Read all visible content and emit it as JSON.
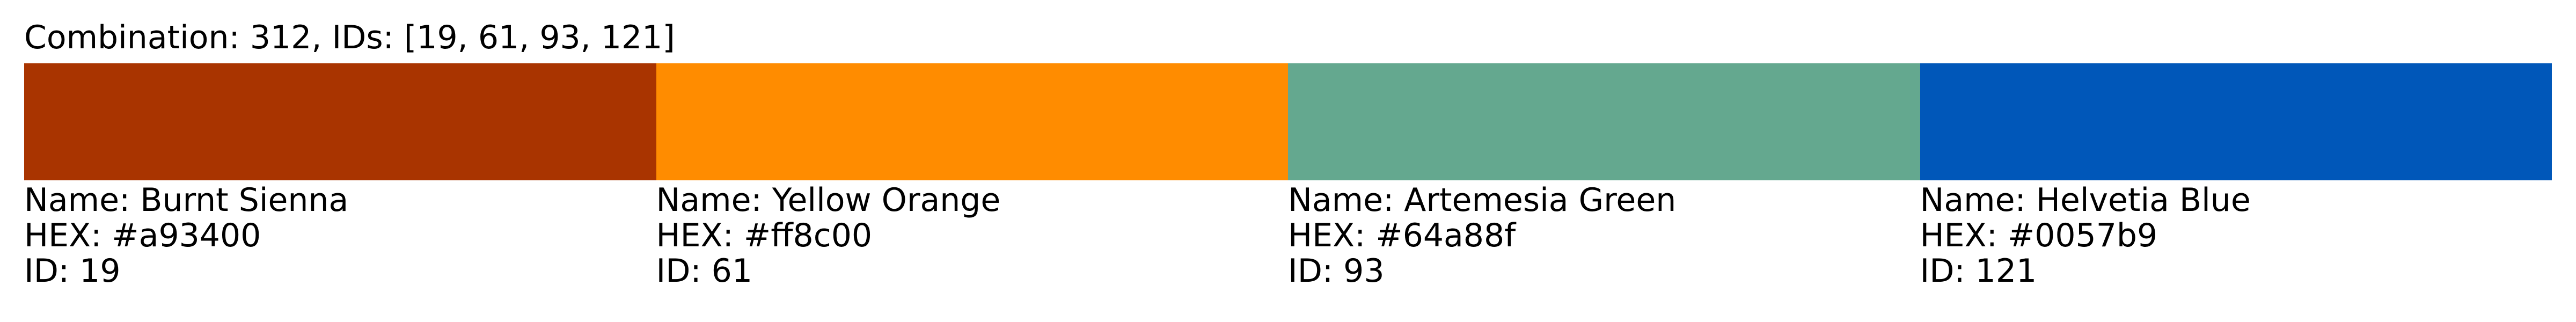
{
  "title": "Combination: 312, IDs: [19, 61, 93, 121]",
  "colors": [
    {
      "name_label": "Name: Burnt Sienna",
      "hex_label": "HEX: #a93400",
      "id_label": "ID: 19",
      "hex": "#a93400"
    },
    {
      "name_label": "Name: Yellow Orange",
      "hex_label": "HEX: #ff8c00",
      "id_label": "ID: 61",
      "hex": "#ff8c00"
    },
    {
      "name_label": "Name: Artemesia Green",
      "hex_label": "HEX: #64a88f",
      "id_label": "ID: 93",
      "hex": "#64a88f"
    },
    {
      "name_label": "Name: Helvetia Blue",
      "hex_label": "HEX: #0057b9",
      "id_label": "ID: 121",
      "hex": "#0057b9"
    }
  ]
}
